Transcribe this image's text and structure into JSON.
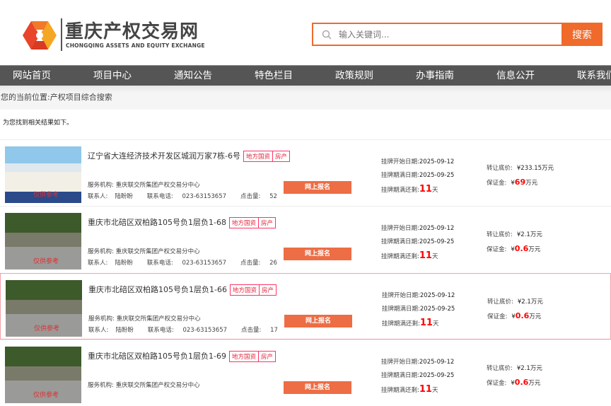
{
  "logo": {
    "cn": "重庆产权交易网",
    "en": "CHONGQING ASSETS AND EQUITY EXCHANGE"
  },
  "search": {
    "placeholder": "输入关键词...",
    "button": "搜索"
  },
  "nav": [
    "网站首页",
    "项目中心",
    "通知公告",
    "特色栏目",
    "政策规则",
    "办事指南",
    "信息公开",
    "联系我们"
  ],
  "breadcrumb": "您的当前位置:产权项目综合搜索",
  "found_text": "为您找到相关结果如下。",
  "labels": {
    "org": "服务机构: ",
    "contact": "联系人:",
    "phone": "联系电话: ",
    "clicks": "点击量: ",
    "apply": "网上报名",
    "start": "挂牌开始日期:",
    "end": "挂牌期满日期:",
    "remain": "挂牌期满还剩:",
    "day_unit": "天",
    "price": "转让底价:",
    "deposit": "保证金:",
    "yen": "¥",
    "wan": "万元",
    "watermark": "仅供参考"
  },
  "results": [
    {
      "title": "辽宁省大连经济技术开发区城润万家7栋-6号",
      "tags": [
        "地方国资",
        "房产"
      ],
      "org": "重庆联交所集团产权交易分中心",
      "contact": "陆盼盼",
      "phone": "023-63153657",
      "clicks": "52",
      "start": "2025-09-12",
      "end": "2025-09-25",
      "remain": "11",
      "price": "233.15",
      "deposit": "69"
    },
    {
      "title": "重庆市北碚区双柏路105号负1层负1-68",
      "tags": [
        "地方国资",
        "房产"
      ],
      "org": "重庆联交所集团产权交易分中心",
      "contact": "陆盼盼",
      "phone": "023-63153657",
      "clicks": "26",
      "start": "2025-09-12",
      "end": "2025-09-25",
      "remain": "11",
      "price": "2.1",
      "deposit": "0.6"
    },
    {
      "title": "重庆市北碚区双柏路105号负1层负1-66",
      "tags": [
        "地方国资",
        "房产"
      ],
      "org": "重庆联交所集团产权交易分中心",
      "contact": "陆盼盼",
      "phone": "023-63153657",
      "clicks": "17",
      "start": "2025-09-12",
      "end": "2025-09-25",
      "remain": "11",
      "price": "2.1",
      "deposit": "0.6"
    },
    {
      "title": "重庆市北碚区双柏路105号负1层负1-69",
      "tags": [
        "地方国资",
        "房产"
      ],
      "org": "重庆联交所集团产权交易分中心",
      "contact": "",
      "phone": "",
      "clicks": "",
      "start": "2025-09-12",
      "end": "2025-09-25",
      "remain": "11",
      "price": "2.1",
      "deposit": "0.6"
    }
  ]
}
